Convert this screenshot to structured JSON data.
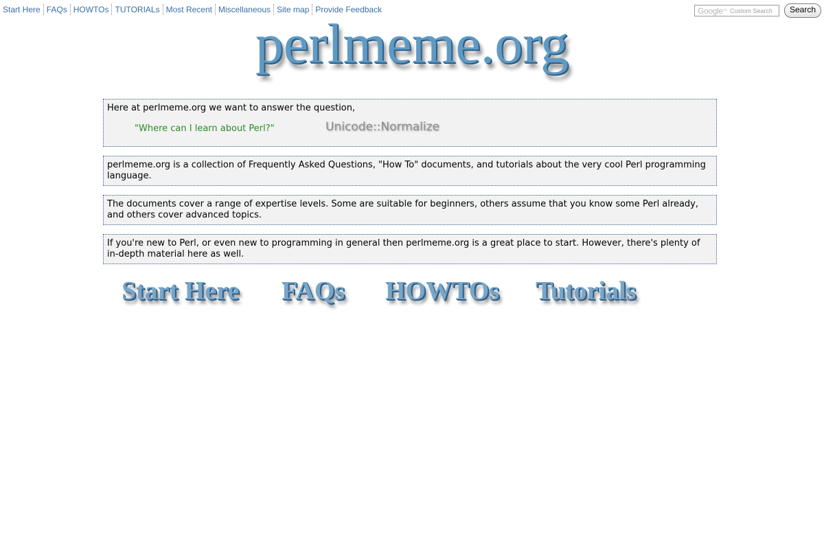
{
  "top_nav": {
    "items": [
      {
        "label": "Start Here"
      },
      {
        "label": "FAQs"
      },
      {
        "label": "HOWTOs"
      },
      {
        "label": "TUTORIALs"
      },
      {
        "label": "Most Recent"
      },
      {
        "label": "Miscellaneous"
      },
      {
        "label": "Site map"
      },
      {
        "label": "Provide Feedback"
      }
    ]
  },
  "search": {
    "google_label": "Google",
    "tm": "™",
    "custom_search_label": "Custom Search",
    "button_label": "Search"
  },
  "logo": {
    "text": "perlmeme.org"
  },
  "intro": {
    "line": "Here at perlmeme.org we want to answer the question,",
    "quote": "\"Where can I learn about Perl?\"",
    "module": "Unicode::Normalize"
  },
  "paragraphs": [
    "perlmeme.org is a collection of Frequently Asked Questions, \"How To\" documents, and tutorials about the very cool Perl programming language.",
    "The documents cover a range of expertise levels. Some are suitable for beginners, others assume that you know some Perl already, and others cover advanced topics.",
    "If you're new to Perl, or even new to programming in general then perlmeme.org is a great place to start. However, there's plenty of in-depth material here as well."
  ],
  "big_nav": {
    "start_here": "Start Here",
    "faqs": "FAQs",
    "howtos": "HOWTOs",
    "tutorials": "Tutorials"
  },
  "colors": {
    "link": "#3a6ea5",
    "box_border": "#3a5b94",
    "box_bg": "#f2f2f2",
    "quote_green": "#2a8a2a",
    "logo_blue": "#5f9ac4"
  }
}
